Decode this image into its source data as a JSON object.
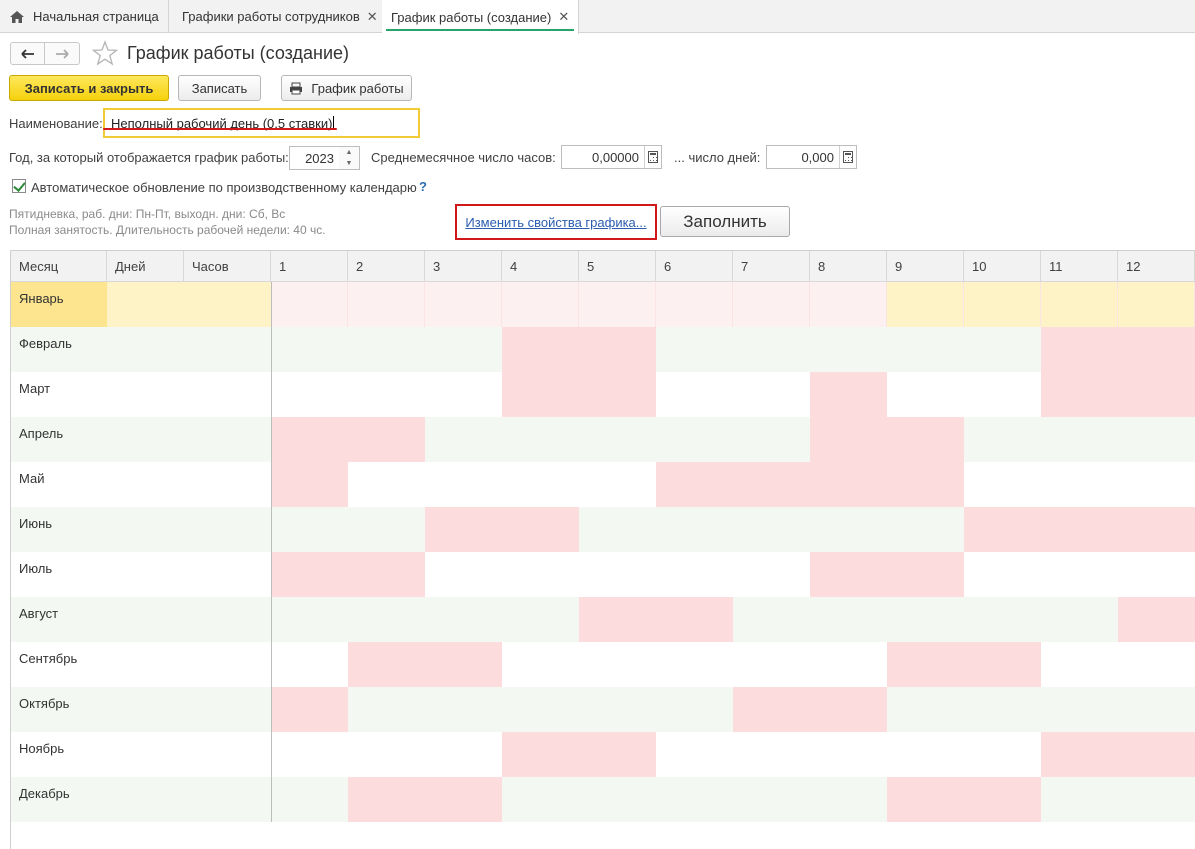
{
  "tabs": [
    {
      "label": "Начальная страница",
      "closable": false,
      "active": false
    },
    {
      "label": "Графики работы сотрудников",
      "closable": true,
      "active": false
    },
    {
      "label": "График работы (создание)",
      "closable": true,
      "active": true
    }
  ],
  "header": {
    "title": "График работы (создание)"
  },
  "toolbar": {
    "save_close": "Записать и закрыть",
    "save": "Записать",
    "schedule": "График работы"
  },
  "form": {
    "name_label": "Наименование:",
    "name_value": "Неполный рабочий день (0,5 ставки)",
    "year_label": "Год, за который отображается график работы:",
    "year_value": "2023",
    "avg_hours_label": "Среднемесячное число часов:",
    "avg_hours_value": "0,00000",
    "days_label": "... число дней:",
    "days_value": "0,000",
    "auto_update_label": "Автоматическое обновление по производственному календарю",
    "auto_update_checked": true,
    "help": "?",
    "info_line1": "Пятидневка, раб. дни: Пн-Пт, выходн. дни: Сб, Вс",
    "info_line2": "Полная занятость. Длительность рабочей недели: 40 чс.",
    "change_props_link": "Изменить свойства графика...",
    "fill_button": "Заполнить"
  },
  "grid": {
    "headers": {
      "month": "Месяц",
      "days": "Дней",
      "hours": "Часов"
    },
    "day_headers": [
      "1",
      "2",
      "3",
      "4",
      "5",
      "6",
      "7",
      "8",
      "9",
      "10",
      "11",
      "12"
    ],
    "months": [
      "Январь",
      "Февраль",
      "Март",
      "Апрель",
      "Май",
      "Июнь",
      "Июль",
      "Август",
      "Сентябрь",
      "Октябрь",
      "Ноябрь",
      "Декабрь"
    ],
    "weekend_pattern": [
      [
        1,
        1,
        1,
        1,
        1,
        1,
        1,
        1,
        0,
        0,
        0,
        0
      ],
      [
        0,
        0,
        0,
        1,
        1,
        0,
        0,
        0,
        0,
        0,
        1,
        1
      ],
      [
        0,
        0,
        0,
        1,
        1,
        0,
        0,
        1,
        0,
        0,
        1,
        1
      ],
      [
        1,
        1,
        0,
        0,
        0,
        0,
        0,
        1,
        1,
        0,
        0,
        0
      ],
      [
        1,
        0,
        0,
        0,
        0,
        1,
        1,
        1,
        1,
        0,
        0,
        0
      ],
      [
        0,
        0,
        1,
        1,
        0,
        0,
        0,
        0,
        0,
        1,
        1,
        1
      ],
      [
        1,
        1,
        0,
        0,
        0,
        0,
        0,
        1,
        1,
        0,
        0,
        0
      ],
      [
        0,
        0,
        0,
        0,
        1,
        1,
        0,
        0,
        0,
        0,
        0,
        1
      ],
      [
        0,
        1,
        1,
        0,
        0,
        0,
        0,
        0,
        1,
        1,
        0,
        0
      ],
      [
        1,
        0,
        0,
        0,
        0,
        0,
        1,
        1,
        0,
        0,
        0,
        0
      ],
      [
        0,
        0,
        0,
        1,
        1,
        0,
        0,
        0,
        0,
        0,
        1,
        1
      ],
      [
        0,
        1,
        1,
        0,
        0,
        0,
        0,
        0,
        1,
        1,
        0,
        0
      ]
    ],
    "selected_row": 0,
    "colors": {
      "weekend": "#fcdcdc",
      "selected_weekend": "#fdf0f0",
      "selected_workday": "#fdf3c7",
      "selected_month": "#fde48e",
      "alt_row": "#f3f8f3",
      "row": "#ffffff"
    }
  }
}
